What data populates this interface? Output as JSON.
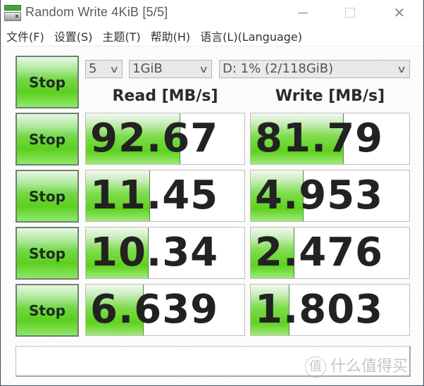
{
  "window": {
    "title": "Random Write 4KiB [5/5]",
    "controls": {
      "minimize": "—",
      "maximize": "☐",
      "close": "✕"
    }
  },
  "menu": {
    "items": [
      {
        "label": "文件(F)"
      },
      {
        "label": "设置(S)"
      },
      {
        "label": "主题(T)"
      },
      {
        "label": "帮助(H)"
      },
      {
        "label": "语言(L)(Language)"
      }
    ]
  },
  "controls": {
    "all_button_label": "Stop",
    "count_select": {
      "value": "5"
    },
    "size_select": {
      "value": "1GiB"
    },
    "drive_select": {
      "value": "D: 1% (2/118GiB)"
    },
    "chevron": "∨"
  },
  "headers": {
    "read": "Read [MB/s]",
    "write": "Write [MB/s]"
  },
  "rows": [
    {
      "button_label": "Stop",
      "read": "92.67",
      "write": "81.79",
      "read_fill_pct": 59,
      "write_fill_pct": 58
    },
    {
      "button_label": "Stop",
      "read": "11.45",
      "write": "4.953",
      "read_fill_pct": 40,
      "write_fill_pct": 33
    },
    {
      "button_label": "Stop",
      "read": "10.34",
      "write": "2.476",
      "read_fill_pct": 39,
      "write_fill_pct": 27
    },
    {
      "button_label": "Stop",
      "read": "6.639",
      "write": "1.803",
      "read_fill_pct": 36,
      "write_fill_pct": 24
    }
  ],
  "comment": {
    "value": ""
  },
  "watermark": {
    "badge": "值",
    "text": "什么值得买"
  },
  "colors": {
    "accent_green": "#5ed21c",
    "border_teal": "#2f4f5f"
  }
}
